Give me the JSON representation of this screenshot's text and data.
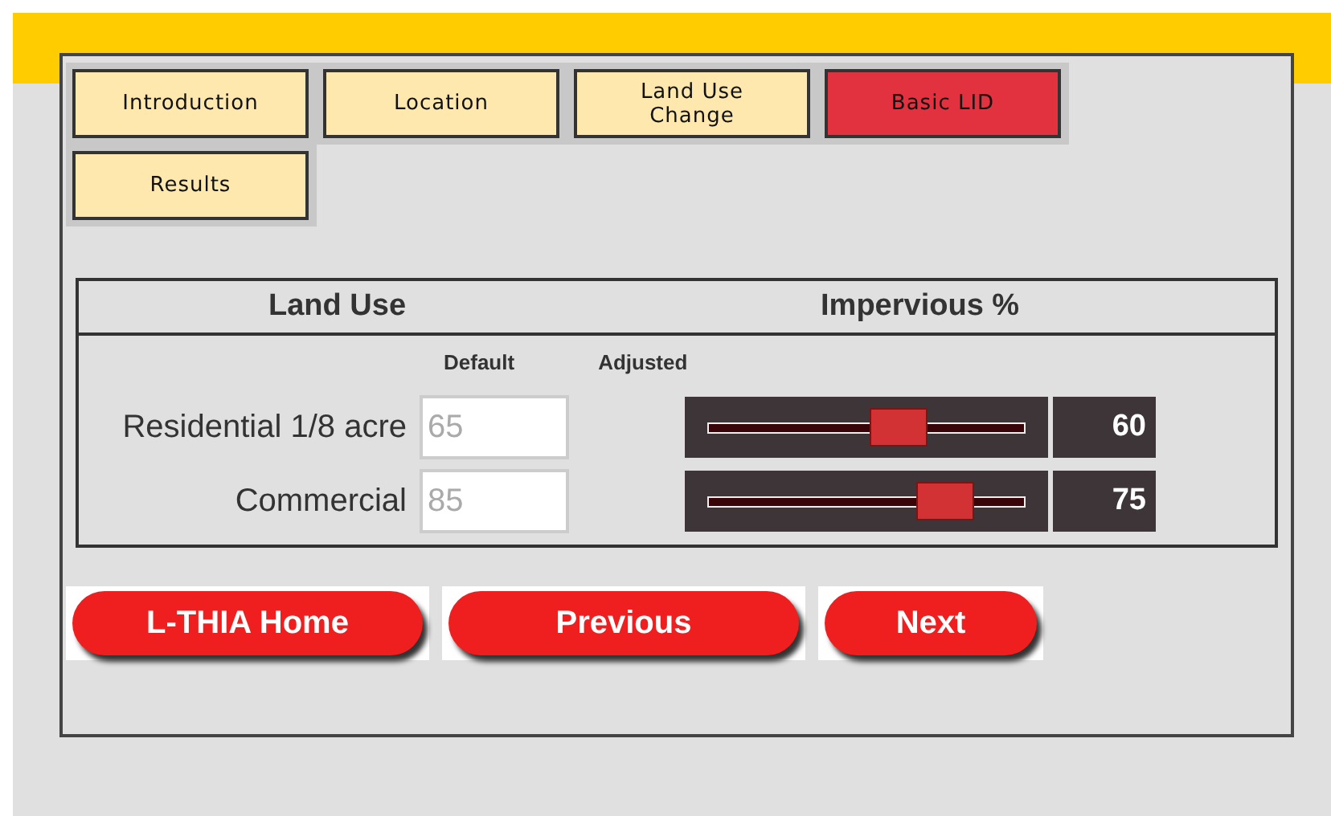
{
  "tabs": [
    {
      "label": "Introduction",
      "selected": false
    },
    {
      "label": "Location",
      "selected": false
    },
    {
      "label": "Land Use Change",
      "selected": false
    },
    {
      "label": "Basic LID",
      "selected": true
    },
    {
      "label": "Results",
      "selected": false
    }
  ],
  "table": {
    "columns": [
      "Land Use",
      "Impervious %"
    ],
    "subheaders": [
      "Default",
      "Adjusted"
    ],
    "rows": [
      {
        "land_use": "Residential 1/8 acre",
        "default": "65",
        "level": 0.6,
        "adjusted": "60"
      },
      {
        "land_use": "Commercial",
        "default": "85",
        "level": 0.75,
        "adjusted": "75"
      }
    ]
  },
  "buttons": [
    "L-THIA Home",
    "Previous",
    "Next"
  ]
}
